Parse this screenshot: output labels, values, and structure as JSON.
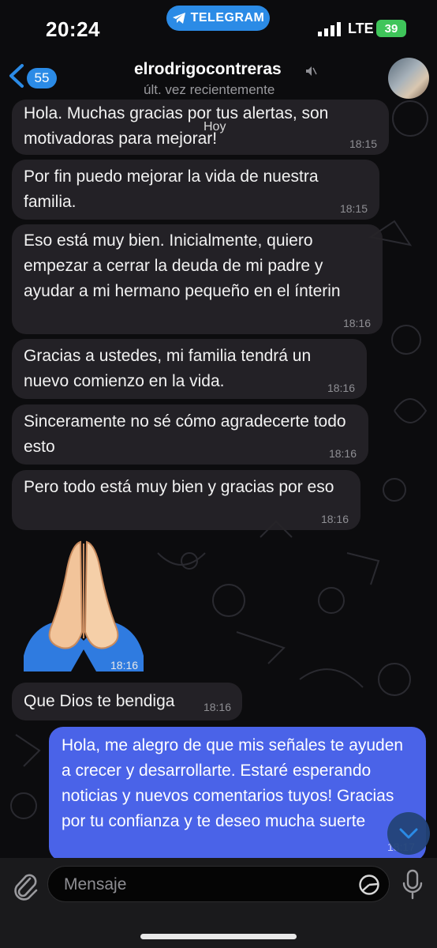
{
  "status_bar": {
    "time": "20:24",
    "app_pill": "TELEGRAM",
    "network": "LTE",
    "battery": "39"
  },
  "header": {
    "back_count": "55",
    "name": "elrodrigocontreras",
    "last_seen": "últ. vez recientemente"
  },
  "date_chip": "Hoy",
  "messages": [
    {
      "text": "Hola. Muchas gracias por tus alertas, son motivadoras para mejorar!",
      "time": "18:15"
    },
    {
      "text": "Por fin puedo mejorar la vida de nuestra familia.",
      "time": "18:15"
    },
    {
      "text": "Eso está muy bien. Inicialmente, quiero empezar a cerrar la deuda de mi padre y ayudar a mi hermano pequeño en el ínterin",
      "time": "18:16"
    },
    {
      "text": "Gracias a ustedes, mi familia tendrá un nuevo comienzo en la vida.",
      "time": "18:16"
    },
    {
      "text": "Sinceramente no sé cómo agradecerte todo esto",
      "time": "18:16"
    },
    {
      "text": "Pero todo está muy bien y gracias por eso",
      "time": "18:16"
    },
    {
      "text": "",
      "time": "18:16",
      "sticker": "folded-hands"
    },
    {
      "text": "Que Dios te bendiga",
      "time": "18:16"
    },
    {
      "text": "Hola, me alegro de que mis señales te ayuden a crecer y desarrollarte. Estaré esperando noticias y nuevos comentarios tuyos! Gracias por tu confianza y te deseo mucha suerte",
      "time": "18:17",
      "outgoing": true
    }
  ],
  "composer": {
    "placeholder": "Mensaje"
  },
  "colors": {
    "accent": "#2b8be6",
    "outgoing_bubble": "#4a63e8",
    "incoming_bubble": "#262428",
    "battery": "#3fc55a"
  }
}
